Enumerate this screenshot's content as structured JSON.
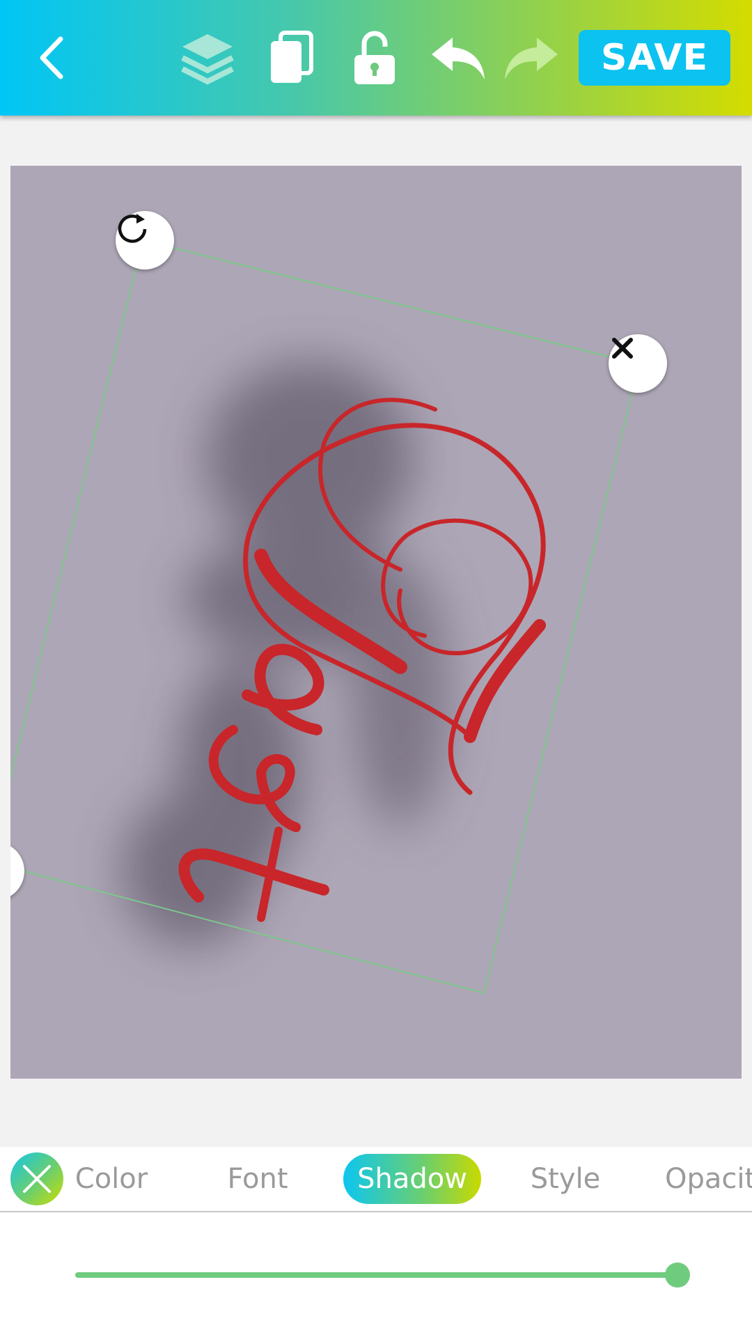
{
  "toolbar": {
    "save_label": "SAVE",
    "icons": [
      "back-icon",
      "layers-icon",
      "duplicate-icon",
      "unlock-icon",
      "undo-icon",
      "redo-icon"
    ]
  },
  "canvas": {
    "background_color": "#ada6b6",
    "text_layer": {
      "text": "Test",
      "color": "#c8262a",
      "shadow": true
    },
    "handles": [
      "rotate-icon",
      "delete-icon"
    ]
  },
  "tabs": [
    {
      "label": "Color",
      "active": false
    },
    {
      "label": "Font",
      "active": false
    },
    {
      "label": "Shadow",
      "active": true
    },
    {
      "label": "Style",
      "active": false
    },
    {
      "label": "Opacit",
      "active": false
    }
  ],
  "slider": {
    "value_fraction": 1.0
  }
}
